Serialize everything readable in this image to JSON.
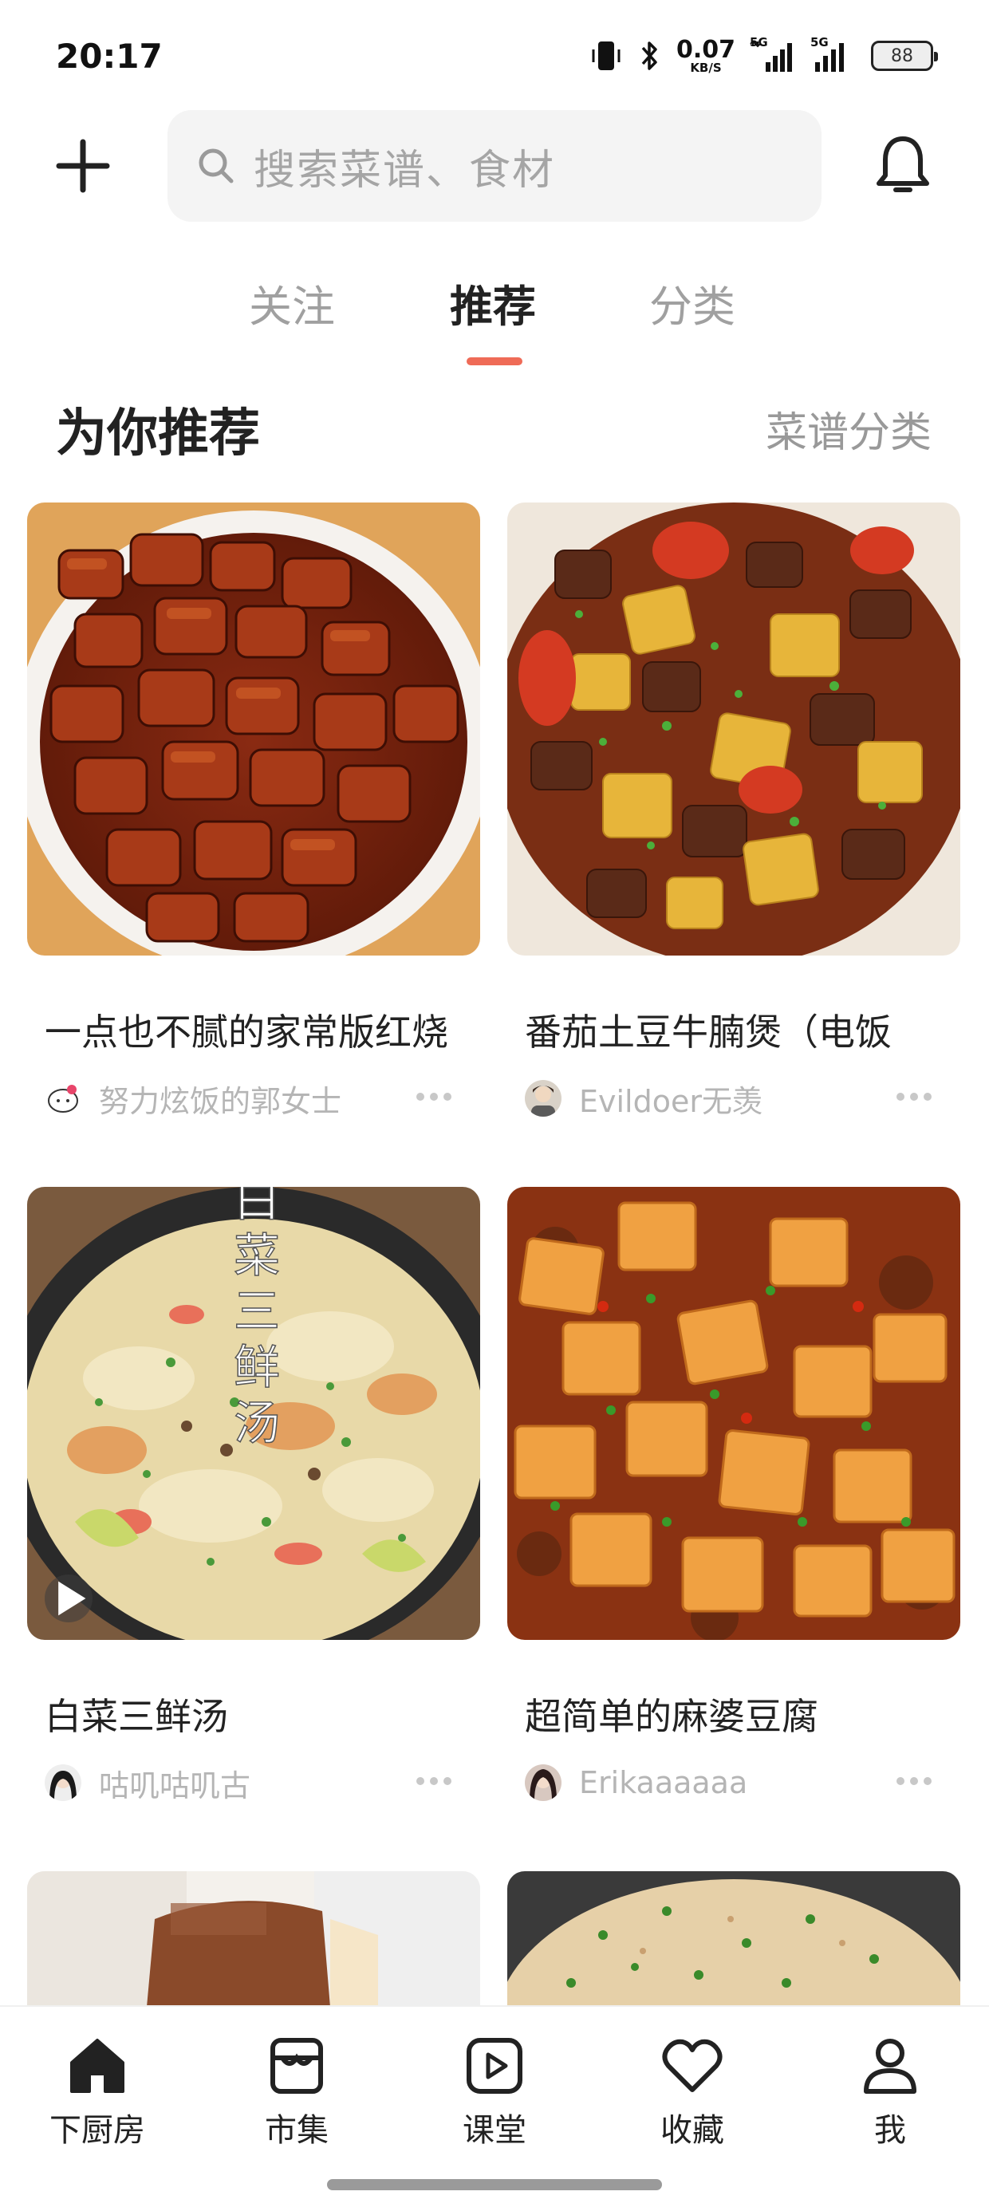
{
  "status_bar": {
    "time": "20:17",
    "net_speed_value": "0.07",
    "net_speed_unit": "KB/S",
    "sim1_label": "5G",
    "sim2_label": "5G",
    "battery": "88"
  },
  "header": {
    "search_placeholder": "搜索菜谱、食材",
    "add_icon": "plus-icon",
    "bell_icon": "bell-icon"
  },
  "tabs": [
    {
      "label": "关注",
      "active": false
    },
    {
      "label": "推荐",
      "active": true
    },
    {
      "label": "分类",
      "active": false
    }
  ],
  "section": {
    "title": "为你推荐",
    "link": "菜谱分类"
  },
  "recipes": [
    {
      "title": "一点也不腻的家常版红烧",
      "author": "努力炫饭的郭女士",
      "has_video": false
    },
    {
      "title": "番茄土豆牛腩煲（电饭",
      "author": "Evildoer无羡",
      "has_video": false
    },
    {
      "title": "白菜三鲜汤",
      "author": "咕叽咕叽古",
      "has_video": true,
      "image_text": "白菜三鲜汤"
    },
    {
      "title": "超简单的麻婆豆腐",
      "author": "Erikaaaaaa",
      "has_video": false
    }
  ],
  "bottom_nav": [
    {
      "label": "下厨房",
      "icon": "home-icon",
      "active": true
    },
    {
      "label": "市集",
      "icon": "market-icon",
      "active": false
    },
    {
      "label": "课堂",
      "icon": "play-icon",
      "active": false
    },
    {
      "label": "收藏",
      "icon": "heart-icon",
      "active": false
    },
    {
      "label": "我",
      "icon": "person-icon",
      "active": false
    }
  ],
  "colors": {
    "accent": "#ef6b57",
    "search_bg": "#f4f4f4",
    "muted_text": "#a0a0a0"
  }
}
